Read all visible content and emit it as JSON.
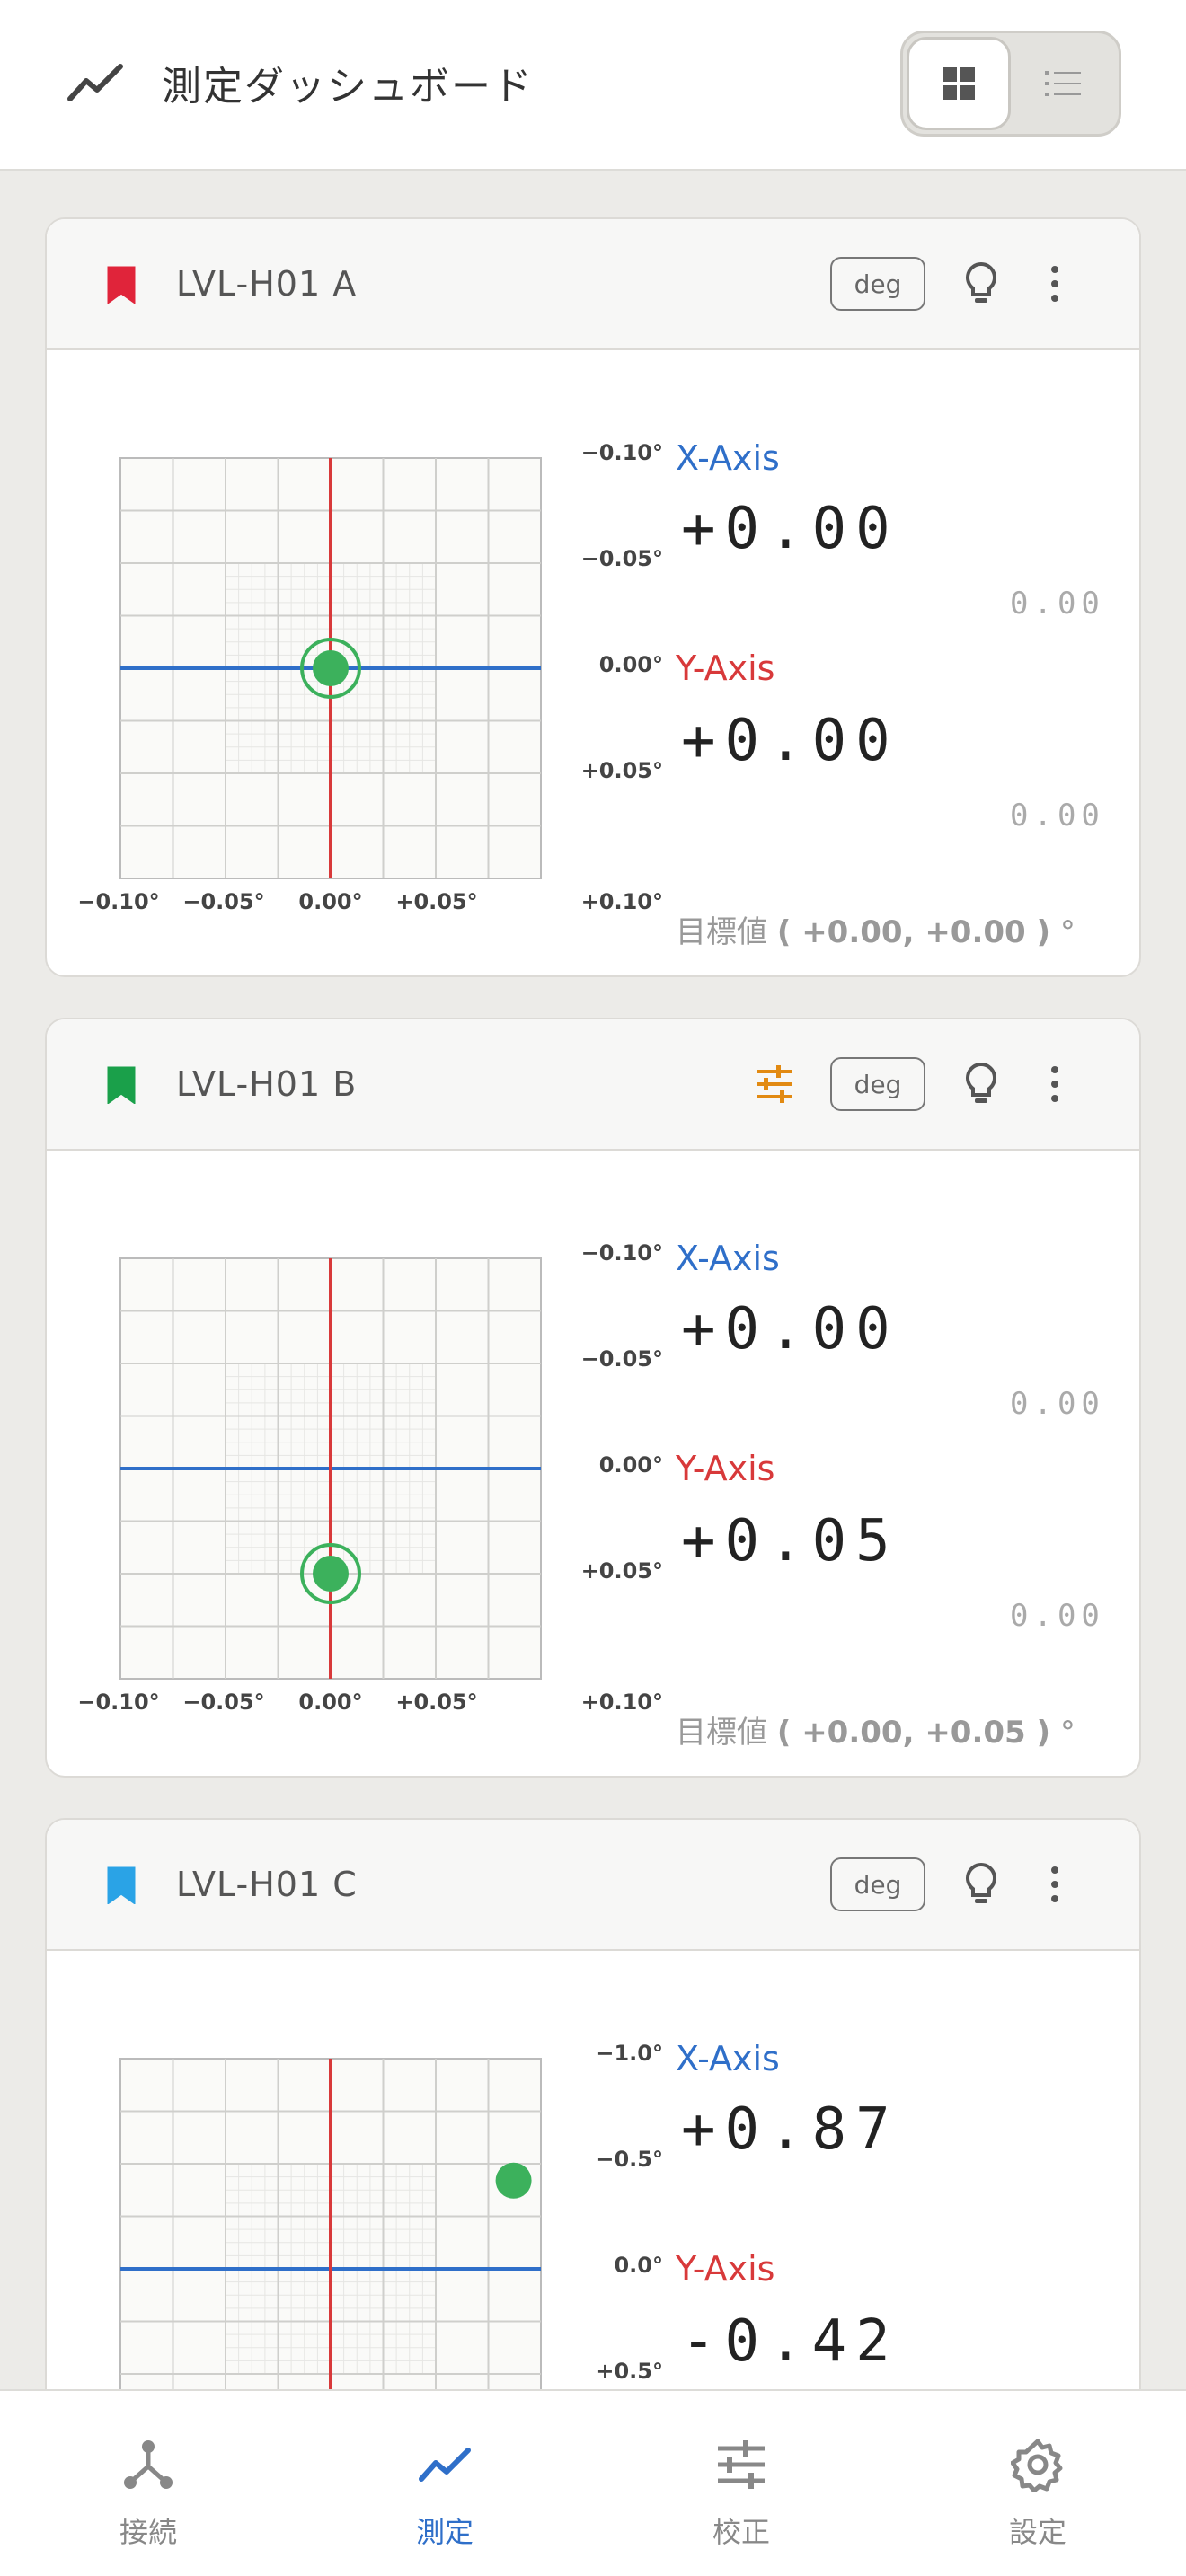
{
  "app": {
    "title": "測定ダッシュボード",
    "title_icon": "trend-line-icon",
    "view_toggle": {
      "active": "grid",
      "options": [
        "grid-view-icon",
        "list-view-icon"
      ]
    }
  },
  "colors": {
    "x_axis": "#2f6fc9",
    "y_axis": "#d8393a",
    "point": "#3cb15c",
    "active_nav": "#2f6fc9"
  },
  "cards": [
    {
      "name": "LVL-H01 A",
      "bookmark_color": "#e0243a",
      "unit_badge": "deg",
      "has_tune_icon": false,
      "x_label": "X-Axis",
      "x_value": "+0.00",
      "x_sub": "0.00",
      "y_label": "Y-Axis",
      "y_value": "+0.00",
      "y_sub": "0.00",
      "target_prefix": "目標値",
      "target_value": "( +0.00, +0.00 )",
      "target_unit": "°",
      "range": 0.1,
      "y_ticks": [
        "−0.10°",
        "−0.05°",
        "0.00°",
        "+0.05°",
        "+0.10°"
      ],
      "x_ticks": [
        "−0.10°",
        "−0.05°",
        "0.00°",
        "+0.05°"
      ],
      "point": {
        "x": 0.0,
        "y": 0.0
      },
      "target_ring": {
        "x": 0.0,
        "y": 0.0
      }
    },
    {
      "name": "LVL-H01 B",
      "bookmark_color": "#1aa04a",
      "unit_badge": "deg",
      "has_tune_icon": true,
      "x_label": "X-Axis",
      "x_value": "+0.00",
      "x_sub": "0.00",
      "y_label": "Y-Axis",
      "y_value": "+0.05",
      "y_sub": "0.00",
      "target_prefix": "目標値",
      "target_value": "( +0.00, +0.05 )",
      "target_unit": "°",
      "range": 0.1,
      "y_ticks": [
        "−0.10°",
        "−0.05°",
        "0.00°",
        "+0.05°",
        "+0.10°"
      ],
      "x_ticks": [
        "−0.10°",
        "−0.05°",
        "0.00°",
        "+0.05°"
      ],
      "point": {
        "x": 0.0,
        "y": 0.05
      },
      "target_ring": {
        "x": 0.0,
        "y": 0.05
      }
    },
    {
      "name": "LVL-H01 C",
      "bookmark_color": "#2aa3e6",
      "unit_badge": "deg",
      "has_tune_icon": false,
      "x_label": "X-Axis",
      "x_value": "+0.87",
      "x_sub": "",
      "y_label": "Y-Axis",
      "y_value": "-0.42",
      "y_sub": "",
      "target_prefix": "",
      "target_value": "",
      "target_unit": "",
      "range": 1.0,
      "y_ticks": [
        "−1.0°",
        "−0.5°",
        "0.0°",
        "+0.5°"
      ],
      "x_ticks": [],
      "point": {
        "x": 0.87,
        "y": -0.42
      },
      "target_ring": null
    }
  ],
  "bottom_nav": [
    {
      "label": "接続",
      "icon": "connection-icon",
      "active": false
    },
    {
      "label": "測定",
      "icon": "trend-line-icon",
      "active": true
    },
    {
      "label": "校正",
      "icon": "tune-sliders-icon",
      "active": false
    },
    {
      "label": "設定",
      "icon": "gear-icon",
      "active": false
    }
  ]
}
